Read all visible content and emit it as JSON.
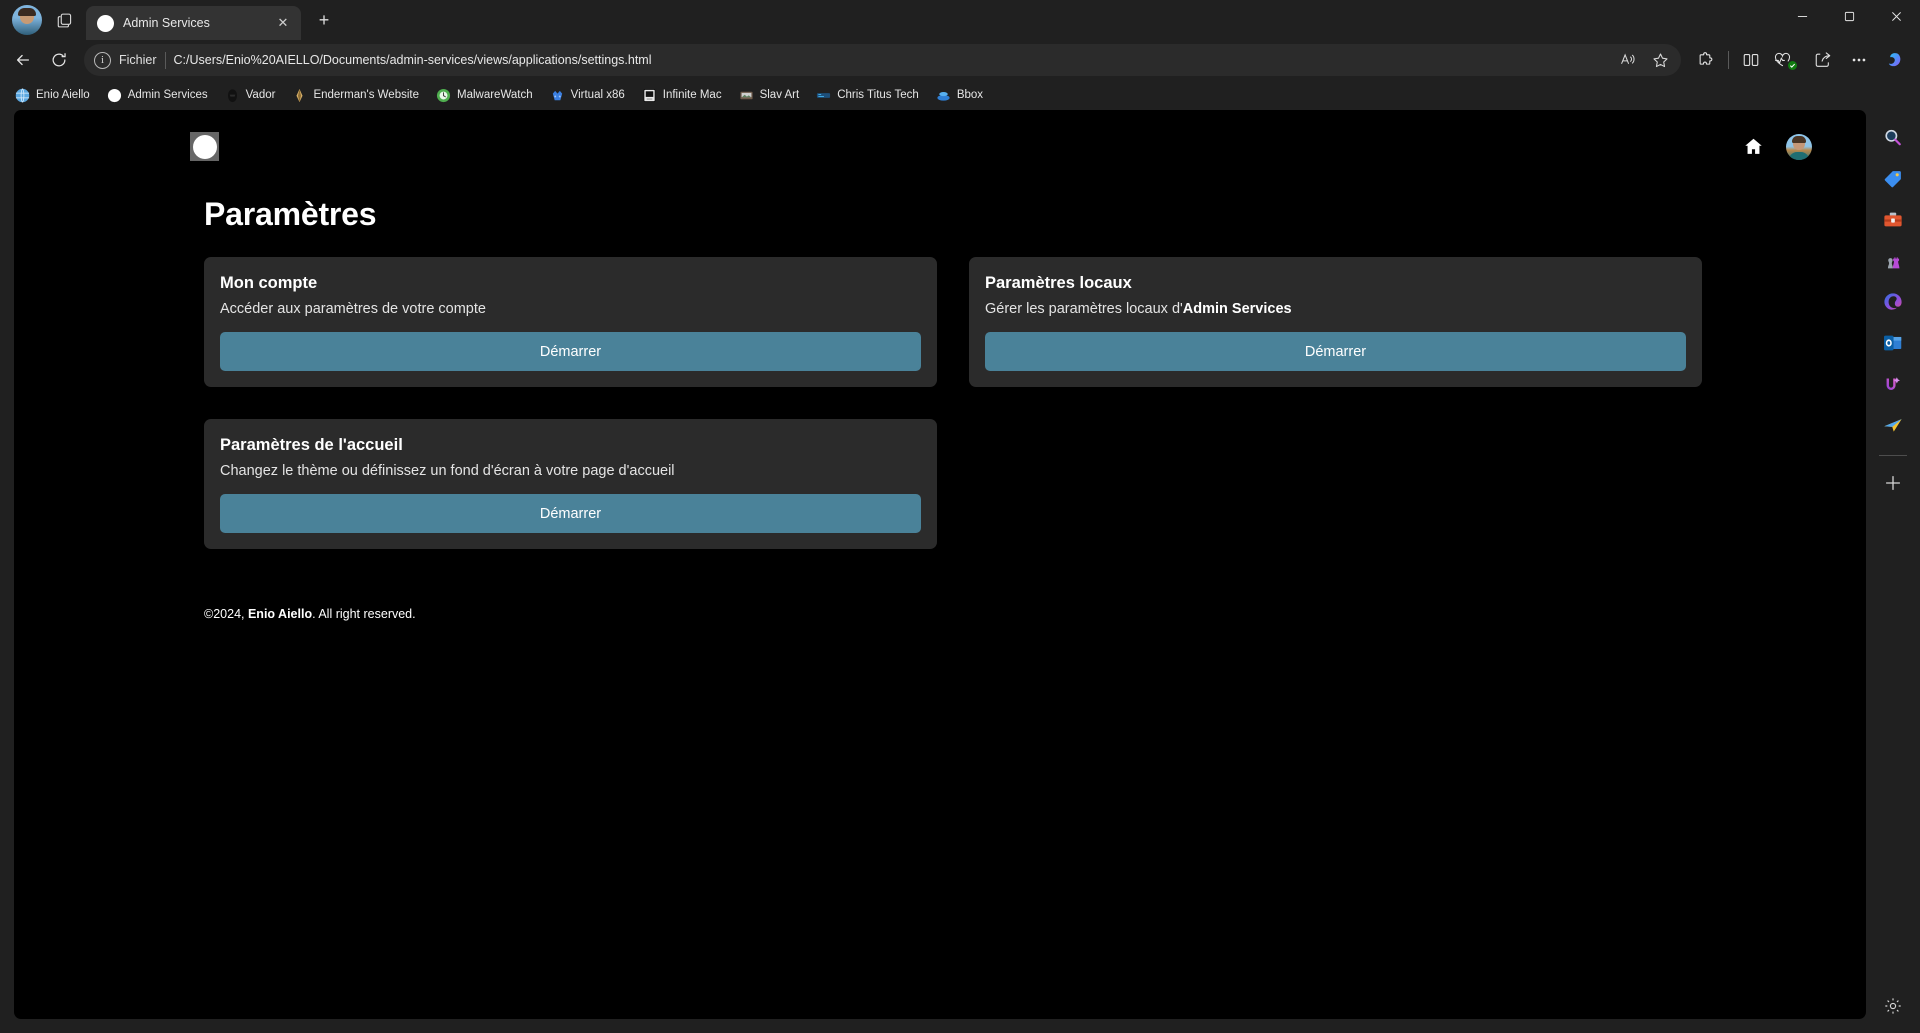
{
  "browser": {
    "tab": {
      "title": "Admin Services",
      "favicon": "white-circle-icon",
      "close_label": "✕"
    },
    "new_tab_label": "+",
    "window_controls": {
      "minimize": "–",
      "maximize": "❐",
      "close": "✕"
    },
    "nav": {
      "back": "←",
      "forward": "→",
      "refresh": "⟳"
    },
    "omnibox": {
      "scheme_label": "Fichier",
      "info_icon": "i",
      "url": "C:/Users/Enio%20AIELLO/Documents/admin-services/views/applications/settings.html",
      "read_aloud": "read-aloud-icon",
      "favorite": "☆"
    },
    "toolbar_icons": [
      "extensions-icon",
      "split-screen-icon",
      "browser-essentials-icon",
      "share-icon",
      "settings-more-icon",
      "copilot-icon"
    ],
    "bookmarks": [
      {
        "label": "Enio Aiello",
        "icon": "globe-icon"
      },
      {
        "label": "Admin Services",
        "icon": "white-circle-icon"
      },
      {
        "label": "Vador",
        "icon": "vader-icon"
      },
      {
        "label": "Enderman's Website",
        "icon": "enderman-icon"
      },
      {
        "label": "MalwareWatch",
        "icon": "malware-icon"
      },
      {
        "label": "Virtual x86",
        "icon": "virtual-x86-icon"
      },
      {
        "label": "Infinite Mac",
        "icon": "mac-icon"
      },
      {
        "label": "Slav Art",
        "icon": "slavart-icon"
      },
      {
        "label": "Chris Titus Tech",
        "icon": "chris-titus-icon"
      },
      {
        "label": "Bbox",
        "icon": "bbox-icon"
      }
    ],
    "sidebar_icons": [
      "search-icon",
      "shopping-tag-icon",
      "tools-icon",
      "games-icon",
      "office-icon",
      "outlook-icon",
      "image-creator-icon",
      "drop-icon"
    ],
    "sidebar_add_label": "+",
    "sidebar_settings": "gear-icon"
  },
  "page": {
    "logo": "white-circle-logo",
    "header_icons": {
      "home": "home-icon",
      "avatar": "user-avatar"
    },
    "title": "Paramètres",
    "cards": [
      {
        "id": "account",
        "title": "Mon compte",
        "desc_plain": "Accéder aux paramètres de votre compte",
        "desc_prefix": "Accéder aux paramètres de votre compte",
        "desc_bold": "",
        "button": "Démarrer"
      },
      {
        "id": "local",
        "title": "Paramètres locaux",
        "desc_plain": "Gérer les paramètres locaux d'Admin Services",
        "desc_prefix": "Gérer les paramètres locaux d'",
        "desc_bold": "Admin Services",
        "button": "Démarrer"
      },
      {
        "id": "home",
        "title": "Paramètres de l'accueil",
        "desc_plain": "Changez le thème ou définissez un fond d'écran à votre page d'accueil",
        "desc_prefix": "Changez le thème ou définissez un fond d'écran à votre page d'accueil",
        "desc_bold": "",
        "button": "Démarrer"
      }
    ],
    "footer": {
      "prefix": "©2024, ",
      "name": "Enio Aiello",
      "suffix": ". All right reserved."
    }
  },
  "colors": {
    "accent_button": "#4a8299",
    "card_bg": "#2b2b2b",
    "page_bg": "#000000",
    "chrome_bg": "#202020"
  }
}
